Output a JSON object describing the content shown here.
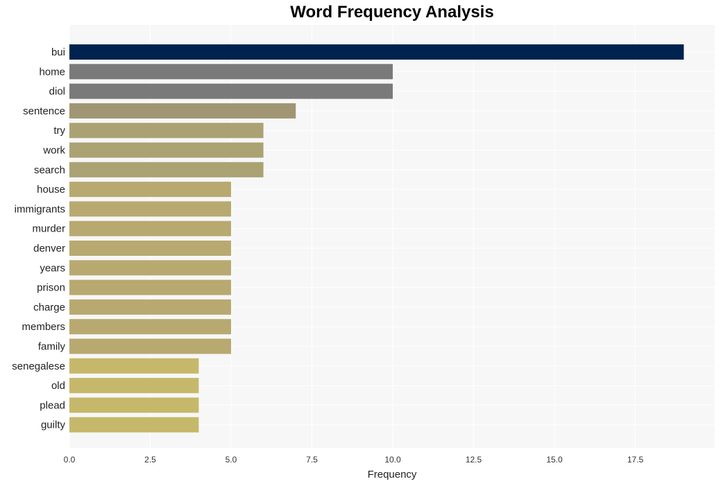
{
  "chart_data": {
    "type": "bar",
    "orientation": "horizontal",
    "title": "Word Frequency Analysis",
    "xlabel": "Frequency",
    "ylabel": "",
    "xlim": [
      0,
      19.9
    ],
    "xticks": [
      "0.0",
      "2.5",
      "5.0",
      "7.5",
      "10.0",
      "12.5",
      "15.0",
      "17.5"
    ],
    "xtick_values": [
      0,
      2.5,
      5,
      7.5,
      10,
      12.5,
      15,
      17.5
    ],
    "grid": true,
    "categories": [
      "bui",
      "home",
      "diol",
      "sentence",
      "try",
      "work",
      "search",
      "house",
      "immigrants",
      "murder",
      "denver",
      "years",
      "prison",
      "charge",
      "members",
      "family",
      "senegalese",
      "old",
      "plead",
      "guilty"
    ],
    "values": [
      19,
      10,
      10,
      7,
      6,
      6,
      6,
      5,
      5,
      5,
      5,
      5,
      5,
      5,
      5,
      5,
      4,
      4,
      4,
      4
    ],
    "colors": [
      "#00224e",
      "#7a7a7a",
      "#7a7a7a",
      "#a09674",
      "#aba274",
      "#aba274",
      "#aba274",
      "#b8a970",
      "#b8a970",
      "#b8a970",
      "#b8a970",
      "#b8a970",
      "#b8a970",
      "#b8a970",
      "#b8a970",
      "#b8a970",
      "#c6b86a",
      "#c6b86a",
      "#c6b86a",
      "#c6b86a"
    ],
    "background": "#f7f7f7"
  }
}
